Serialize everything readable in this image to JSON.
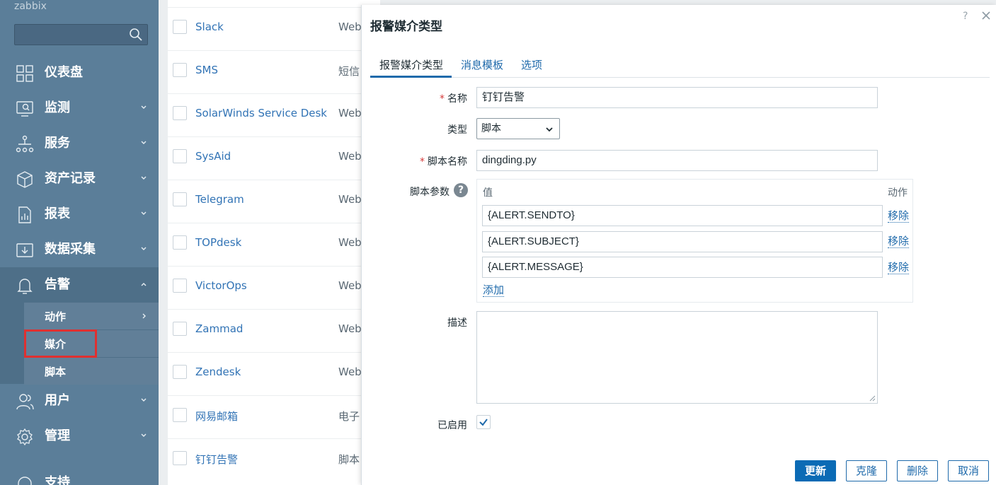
{
  "sidebar": {
    "logo": "zabbix",
    "items": [
      {
        "label": "仪表盘"
      },
      {
        "label": "监测"
      },
      {
        "label": "服务"
      },
      {
        "label": "资产记录"
      },
      {
        "label": "报表"
      },
      {
        "label": "数据采集"
      },
      {
        "label": "告警"
      },
      {
        "label": "用户"
      },
      {
        "label": "管理"
      },
      {
        "label": "支持"
      }
    ],
    "alerts_sub": [
      {
        "label": "动作"
      },
      {
        "label": "媒介"
      },
      {
        "label": "脚本"
      }
    ]
  },
  "list": {
    "rows": [
      {
        "name": "Slack",
        "type": "Web"
      },
      {
        "name": "SMS",
        "type": "短信"
      },
      {
        "name": "SolarWinds Service Desk",
        "type": "Web"
      },
      {
        "name": "SysAid",
        "type": "Web"
      },
      {
        "name": "Telegram",
        "type": "Web"
      },
      {
        "name": "TOPdesk",
        "type": "Web"
      },
      {
        "name": "VictorOps",
        "type": "Web"
      },
      {
        "name": "Zammad",
        "type": "Web"
      },
      {
        "name": "Zendesk",
        "type": "Web"
      },
      {
        "name": "网易邮箱",
        "type": "电子"
      },
      {
        "name": "钉钉告警",
        "type": "脚本"
      }
    ]
  },
  "modal": {
    "title": "报警媒介类型",
    "help": "?",
    "tabs": [
      "报警媒介类型",
      "消息模板",
      "选项"
    ],
    "form": {
      "name_label": "名称",
      "name_value": "钉钉告警",
      "type_label": "类型",
      "type_value": "脚本",
      "script_name_label": "脚本名称",
      "script_name_value": "dingding.py",
      "params_label": "脚本参数",
      "params_help": "?",
      "params_col_value": "值",
      "params_col_action": "动作",
      "params": [
        "{ALERT.SENDTO}",
        "{ALERT.SUBJECT}",
        "{ALERT.MESSAGE}"
      ],
      "remove_label": "移除",
      "add_label": "添加",
      "desc_label": "描述",
      "desc_value": "",
      "enabled_label": "已启用"
    },
    "buttons": {
      "update": "更新",
      "clone": "克隆",
      "delete": "删除",
      "cancel": "取消"
    }
  }
}
